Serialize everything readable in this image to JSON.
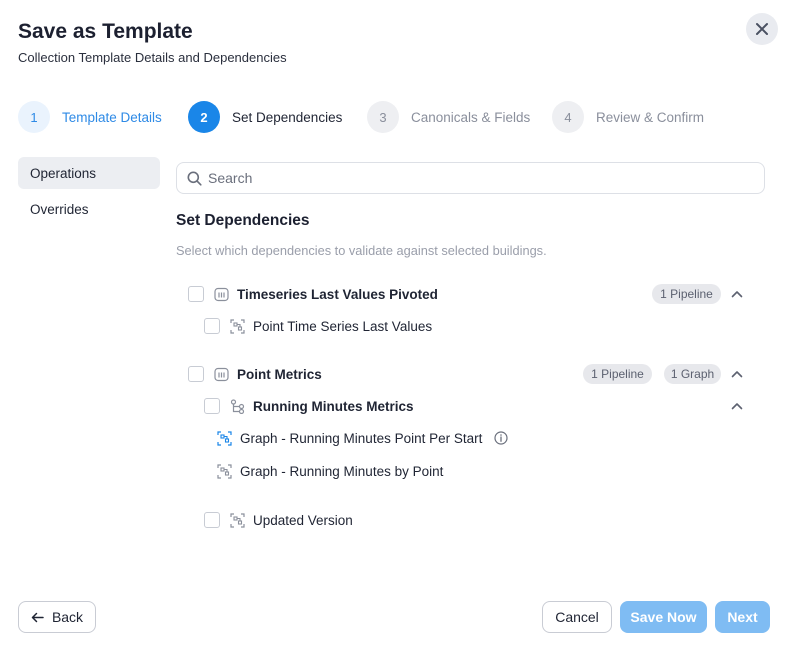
{
  "dialog": {
    "title": "Save as Template",
    "subtitle": "Collection Template Details and Dependencies"
  },
  "icons": {
    "close": "close-icon",
    "search": "search-icon",
    "back": "arrow-left-icon",
    "pipeline": "pipeline-icon",
    "graph": "graph-icon",
    "node": "node-link-icon",
    "info": "info-icon",
    "chevron": "chevron-up-icon"
  },
  "colors": {
    "accent": "#1a86e8",
    "accent_light": "#7fbcf3",
    "muted": "#9a9eaa"
  },
  "steps": [
    {
      "number": "1",
      "label": "Template Details",
      "state": "done"
    },
    {
      "number": "2",
      "label": "Set Dependencies",
      "state": "active"
    },
    {
      "number": "3",
      "label": "Canonicals & Fields",
      "state": "todo"
    },
    {
      "number": "4",
      "label": "Review & Confirm",
      "state": "todo"
    }
  ],
  "nav": {
    "items": [
      {
        "label": "Operations",
        "selected": true
      },
      {
        "label": "Overrides",
        "selected": false
      }
    ]
  },
  "search": {
    "placeholder": "Search",
    "value": ""
  },
  "main": {
    "title": "Set Dependencies",
    "description": "Select which dependencies to validate against selected buildings."
  },
  "tree": {
    "group1": {
      "label": "Timeseries Last Values Pivoted",
      "badges": [
        "1 Pipeline"
      ],
      "children": [
        {
          "label": "Point Time Series Last Values"
        }
      ]
    },
    "group2": {
      "label": "Point Metrics",
      "badges": [
        "1 Pipeline",
        "1 Graph"
      ],
      "subgroup": {
        "label": "Running Minutes Metrics",
        "children": [
          {
            "label": "Graph - Running Minutes Point Per Start"
          },
          {
            "label": "Graph - Running Minutes by Point"
          }
        ]
      },
      "child": {
        "label": "Updated Version"
      }
    }
  },
  "footer": {
    "back_label": "Back",
    "cancel_label": "Cancel",
    "save_now_label": "Save Now",
    "next_label": "Next"
  }
}
